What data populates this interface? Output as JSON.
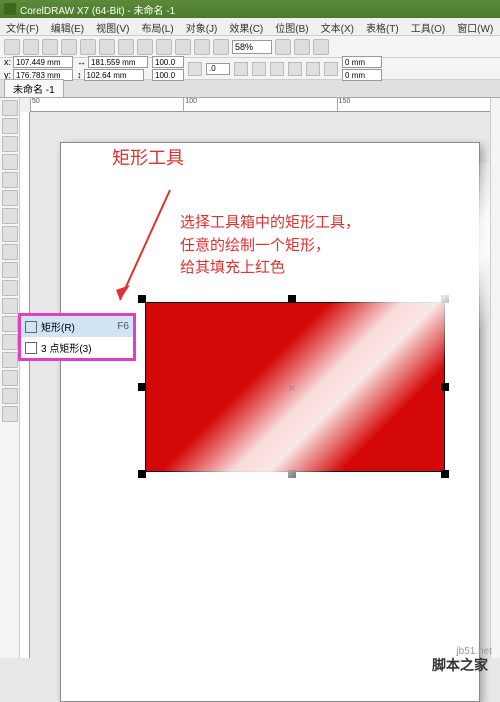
{
  "title": "CorelDRAW X7 (64-Bit) - 未命名 -1",
  "menu": [
    "文件(F)",
    "编辑(E)",
    "视图(V)",
    "布局(L)",
    "对象(J)",
    "效果(C)",
    "位图(B)",
    "文本(X)",
    "表格(T)",
    "工具(O)",
    "窗口(W)"
  ],
  "coords": {
    "x_label": "x:",
    "x_value": "107.449 mm",
    "y_label": "y:",
    "y_value": "176.783 mm",
    "w_value": "181.559 mm",
    "h_value": "102.64 mm",
    "sx": "100.0",
    "sy": "100.0",
    "rot": ".0"
  },
  "zoom": "58%",
  "outline_mm": "0 mm",
  "doc_tab": "未命名 -1",
  "ruler_marks": [
    "50",
    "100",
    "150"
  ],
  "flyout": {
    "rect_label": "矩形(R)",
    "rect_shortcut": "F6",
    "three_pt_label": "3 点矩形(3)"
  },
  "annotation": {
    "title": "矩形工具",
    "line1": "选择工具箱中的矩形工具，",
    "line2": "任意的绘制一个矩形，",
    "line3": "给其填充上红色"
  },
  "watermark": "jb51.net",
  "footer": "脚本之家"
}
